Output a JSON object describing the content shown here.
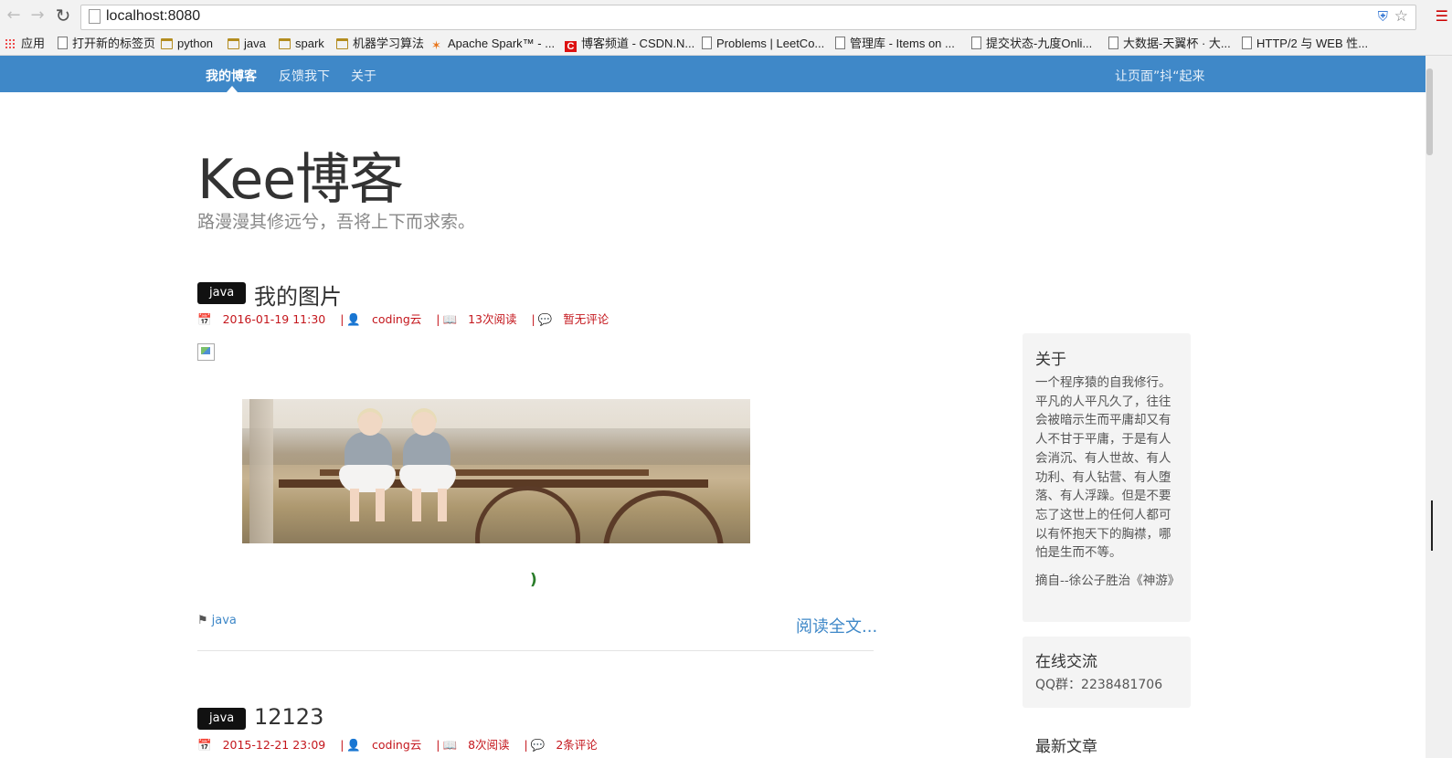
{
  "browser": {
    "url": "localhost:8080",
    "bookmarks": [
      "应用",
      "打开新的标签页",
      "python",
      "java",
      "spark",
      "机器学习算法",
      "Apache Spark™ - ...",
      "博客频道 - CSDN.N...",
      "Problems | LeetCo...",
      "管理库 - Items on ...",
      "提交状态-九度Onli...",
      "大数据-天翼杯 · 大...",
      "HTTP/2 与 WEB 性..."
    ]
  },
  "nav": {
    "items": [
      "我的博客",
      "反馈我下",
      "关于"
    ],
    "right": "让页面”抖“起来"
  },
  "site": {
    "title": "Kee博客",
    "subtitle": "路漫漫其修远兮，吾将上下而求索。"
  },
  "posts": [
    {
      "tag": "java",
      "title": "我的图片",
      "date": "2016-01-19 11:30",
      "author": "coding云",
      "reads": "13次阅读",
      "comments": "暂无评论",
      "paren": ")",
      "footer_tag": "java",
      "read_more": "阅读全文..."
    },
    {
      "tag": "java",
      "title": "12123",
      "date": "2015-12-21 23:09",
      "author": "coding云",
      "reads": "8次阅读",
      "comments": "2条评论"
    }
  ],
  "sidebar": {
    "about": {
      "title": "关于",
      "text": "一个程序猿的自我修行。平凡的人平凡久了，往往会被暗示生而平庸却又有人不甘于平庸，于是有人会消沉、有人世故、有人功利、有人钻营、有人堕落、有人浮躁。但是不要忘了这世上的任何人都可以有怀抱天下的胸襟，哪怕是生而不等。",
      "quote": "摘自--徐公子胜治《神游》"
    },
    "contact": {
      "title": "在线交流",
      "text": "QQ群：2238481706"
    },
    "recent_title": "最新文章"
  }
}
